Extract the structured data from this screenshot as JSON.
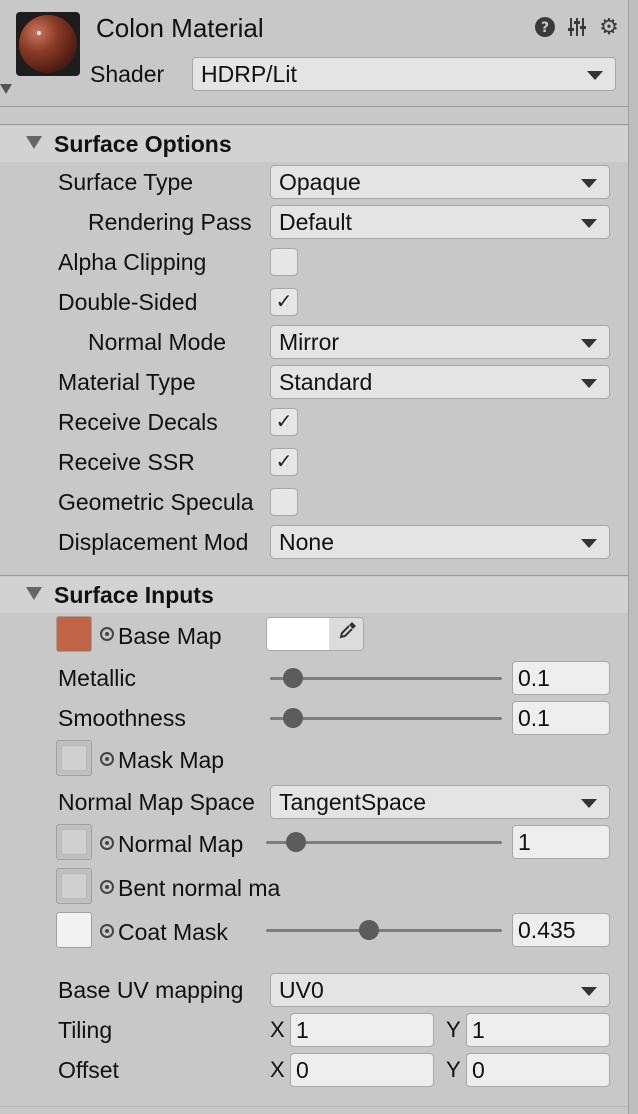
{
  "header": {
    "title": "Colon Material",
    "shader_label": "Shader",
    "shader_value": "HDRP/Lit",
    "icons": [
      "help-icon",
      "preset-icon",
      "gear-icon"
    ]
  },
  "surface_options": {
    "title": "Surface Options",
    "surface_type": {
      "label": "Surface Type",
      "value": "Opaque"
    },
    "rendering_pass": {
      "label": "Rendering Pass",
      "value": "Default"
    },
    "alpha_clipping": {
      "label": "Alpha Clipping",
      "checked": false
    },
    "double_sided": {
      "label": "Double-Sided",
      "checked": true
    },
    "normal_mode": {
      "label": "Normal Mode",
      "value": "Mirror"
    },
    "material_type": {
      "label": "Material Type",
      "value": "Standard"
    },
    "receive_decals": {
      "label": "Receive Decals",
      "checked": true
    },
    "receive_ssr": {
      "label": "Receive SSR",
      "checked": true
    },
    "geometric_specular": {
      "label": "Geometric Specula",
      "checked": false
    },
    "displacement_mode": {
      "label": "Displacement Mod",
      "value": "None"
    }
  },
  "surface_inputs": {
    "title": "Surface Inputs",
    "base_map": {
      "label": "Base Map",
      "tint_color": "#c06448",
      "color": "#ffffff"
    },
    "metallic": {
      "label": "Metallic",
      "value": "0.1",
      "fraction": 0.1
    },
    "smoothness": {
      "label": "Smoothness",
      "value": "0.1",
      "fraction": 0.1
    },
    "mask_map": {
      "label": "Mask Map"
    },
    "normal_map_space": {
      "label": "Normal Map Space",
      "value": "TangentSpace"
    },
    "normal_map": {
      "label": "Normal Map",
      "value": "1",
      "fraction": 0.125
    },
    "bent_normal_map": {
      "label": "Bent normal ma"
    },
    "coat_mask": {
      "label": "Coat Mask",
      "value": "0.435",
      "fraction": 0.435
    },
    "base_uv_mapping": {
      "label": "Base UV mapping",
      "value": "UV0"
    },
    "tiling": {
      "label": "Tiling",
      "x_label": "X",
      "x": "1",
      "y_label": "Y",
      "y": "1"
    },
    "offset": {
      "label": "Offset",
      "x_label": "X",
      "x": "0",
      "y_label": "Y",
      "y": "0"
    }
  }
}
